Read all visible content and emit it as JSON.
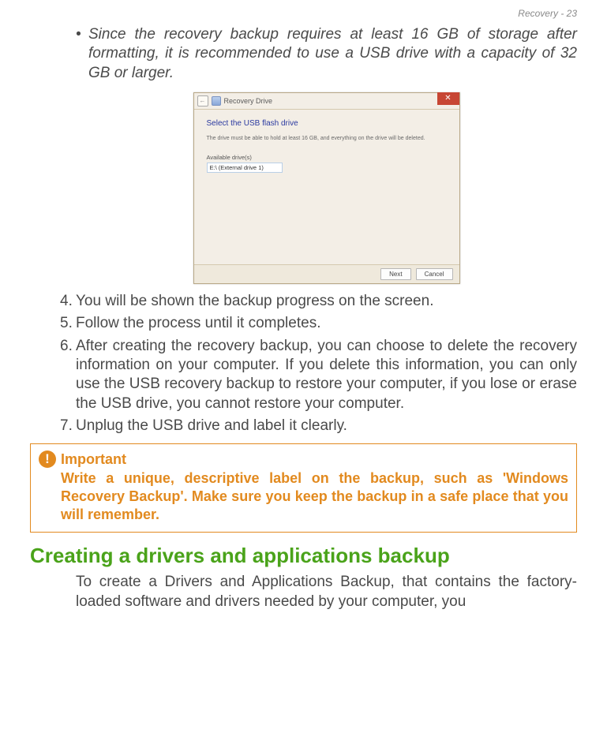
{
  "page_header": "Recovery - 23",
  "bullet_note": "Since the recovery backup requires at least 16 GB of storage after formatting, it is recommended to use a USB drive with a capacity of 32  GB or larger.",
  "dialog": {
    "back_glyph": "←",
    "title": "Recovery Drive",
    "close_glyph": "✕",
    "heading": "Select the USB flash drive",
    "subtext": "The drive must be able to hold at least 16 GB, and everything on the drive will be deleted.",
    "available_label": "Available drive(s)",
    "drive_entry": "E:\\ (External drive 1)",
    "btn_next": "Next",
    "btn_cancel": "Cancel"
  },
  "steps": {
    "s4_num": "4.",
    "s4": "You will be shown the backup progress on the screen.",
    "s5_num": "5.",
    "s5": "Follow the process until it completes.",
    "s6_num": "6.",
    "s6": "After creating the recovery backup, you can choose to delete the recovery information on your computer. If you delete this information, you can only use the USB recovery backup to restore your computer, if you lose or erase the USB drive, you cannot restore your computer.",
    "s7_num": "7.",
    "s7": "Unplug the USB drive and label it clearly."
  },
  "important": {
    "icon_glyph": "!",
    "title": "Important",
    "body": "Write a unique, descriptive label on the backup, such as 'Windows Recovery Backup'. Make sure you keep the backup in a safe place that you will remember."
  },
  "section_heading": "Creating a drivers and applications backup",
  "tail_para": "To create a Drivers and Applications Backup, that contains the factory-loaded software and drivers needed by your computer, you"
}
